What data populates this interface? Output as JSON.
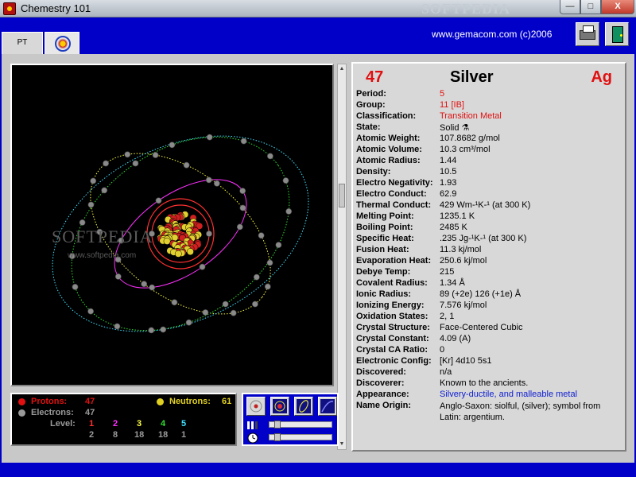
{
  "window": {
    "title": "Chemestry 101",
    "watermark_corner": "SOFTPEDIA",
    "buttons": {
      "minimize": "—",
      "maximize": "□",
      "close": "X"
    }
  },
  "topbar": {
    "tabs": [
      {
        "label": "PT"
      },
      {
        "label": ""
      }
    ],
    "url": "www.gemacom.com  (c)2006",
    "icons": [
      "printer-icon",
      "exit-door-icon"
    ]
  },
  "viewer": {
    "watermark": "SOFTPEDIA",
    "watermark_url": "www.softpedia.com"
  },
  "stats": {
    "protons_label": "Protons:",
    "protons_value": "47",
    "neutrons_label": "Neutrons:",
    "neutrons_value": "61",
    "electrons_label": "Electrons:",
    "electrons_value": "47",
    "level_label": "Level:",
    "levels": [
      {
        "level": "1",
        "count": "2",
        "color": "#ff3030"
      },
      {
        "level": "2",
        "count": "8",
        "color": "#ff30ff"
      },
      {
        "level": "3",
        "count": "18",
        "color": "#ffff40"
      },
      {
        "level": "4",
        "count": "18",
        "color": "#30e030"
      },
      {
        "level": "5",
        "count": "1",
        "color": "#40e0ff"
      }
    ],
    "colors": {
      "protons": "#e01010",
      "neutrons": "#e0d020",
      "electrons": "#9a9a9a"
    }
  },
  "element": {
    "number": "47",
    "name": "Silver",
    "symbol": "Ag",
    "properties": [
      {
        "label": "Period:",
        "value": "5",
        "style": "red"
      },
      {
        "label": "Group:",
        "value": "11      [IB]",
        "style": "red"
      },
      {
        "label": "Classification:",
        "value": "Transition Metal",
        "style": "red"
      },
      {
        "label": "State:",
        "value": "Solid  ⚗",
        "style": ""
      },
      {
        "label": "Atomic Weight:",
        "value": "107.8682    g/mol",
        "style": ""
      },
      {
        "label": "Atomic Volume:",
        "value": "10.3    cm³/mol",
        "style": ""
      },
      {
        "label": "Atomic Radius:",
        "value": "1.44",
        "style": ""
      },
      {
        "label": "Density:",
        "value": "10.5",
        "style": ""
      },
      {
        "label": "Electro Negativity:",
        "value": "1.93",
        "style": ""
      },
      {
        "label": "Electro Conduct:",
        "value": "62.9",
        "style": ""
      },
      {
        "label": "Thermal Conduct:",
        "value": "429    Wm-¹K-¹ (at 300 K)",
        "style": ""
      },
      {
        "label": "Melting Point:",
        "value": "1235.1     K",
        "style": ""
      },
      {
        "label": "Boiling Point:",
        "value": "2485     K",
        "style": ""
      },
      {
        "label": "Specific Heat:",
        "value": ".235    Jg-¹K-¹ (at 300 K)",
        "style": ""
      },
      {
        "label": "Fusion Heat:",
        "value": "11.3     kj/mol",
        "style": ""
      },
      {
        "label": "Evaporation Heat:",
        "value": "250.6     kj/mol",
        "style": ""
      },
      {
        "label": "Debye Temp:",
        "value": "215",
        "style": ""
      },
      {
        "label": "Covalent Radius:",
        "value": "1.34      Å",
        "style": ""
      },
      {
        "label": "Ionic Radius:",
        "value": "89 (+2e) 126 (+1e)    Å",
        "style": ""
      },
      {
        "label": "Ionizing Energy:",
        "value": "7.576      kj/mol",
        "style": ""
      },
      {
        "label": "Oxidation States:",
        "value": "2, 1",
        "style": ""
      },
      {
        "label": "Crystal Structure:",
        "value": "Face-Centered Cubic",
        "style": ""
      },
      {
        "label": "Crystal Constant:",
        "value": "4.09      (A)",
        "style": ""
      },
      {
        "label": "Crystal CA Ratio:",
        "value": "0",
        "style": ""
      },
      {
        "label": "Electronic Config:",
        "value": "[Kr] 4d10 5s1",
        "style": ""
      },
      {
        "label": "Discovered:",
        "value": "n/a",
        "style": ""
      },
      {
        "label": "Discoverer:",
        "value": "Known to the ancients.",
        "style": ""
      },
      {
        "label": "Appearance:",
        "value": "Silvery-ductile, and malleable metal",
        "style": "blue"
      },
      {
        "label": "Name Origin:",
        "value": "Anglo-Saxon: siolful, (silver); symbol from Latin: argentium.",
        "style": "wrap"
      }
    ]
  }
}
